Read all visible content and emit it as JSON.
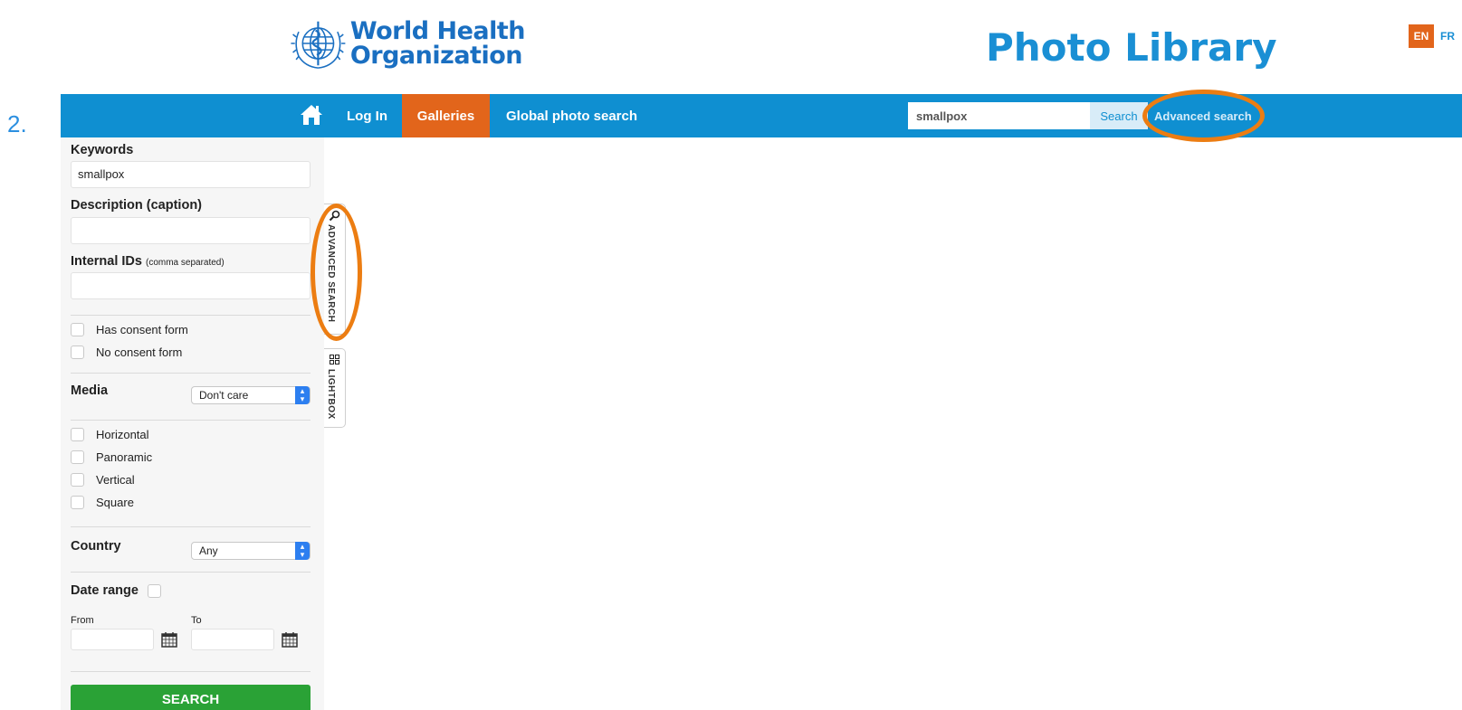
{
  "header": {
    "org_line1": "World Health",
    "org_line2": "Organization",
    "title": "Photo Library",
    "lang_en": "EN",
    "lang_fr": "FR"
  },
  "step_number": "2.",
  "nav": {
    "login": "Log In",
    "galleries": "Galleries",
    "global_search": "Global photo search",
    "search_value": "smallpox",
    "search_button": "Search",
    "advanced_search": "Advanced search"
  },
  "sidebar": {
    "keywords_label": "Keywords",
    "keywords_value": "smallpox",
    "description_label": "Description (caption)",
    "description_value": "",
    "internal_ids_label": "Internal IDs",
    "internal_ids_hint": "(comma separated)",
    "internal_ids_value": "",
    "consent_options": [
      "Has consent form",
      "No consent form"
    ],
    "media_label": "Media",
    "media_value": "Don't care",
    "orientation_options": [
      "Horizontal",
      "Panoramic",
      "Vertical",
      "Square"
    ],
    "country_label": "Country",
    "country_value": "Any",
    "date_range_label": "Date range",
    "from_label": "From",
    "to_label": "To",
    "search_button": "SEARCH"
  },
  "side_tabs": {
    "advanced_search": "ADVANCED SEARCH",
    "lightbox": "LIGHTBOX"
  },
  "colors": {
    "nav_blue": "#0f8fd1",
    "accent_orange": "#e2651b",
    "annotation_orange": "#ec7d12",
    "search_green": "#2aa236"
  }
}
